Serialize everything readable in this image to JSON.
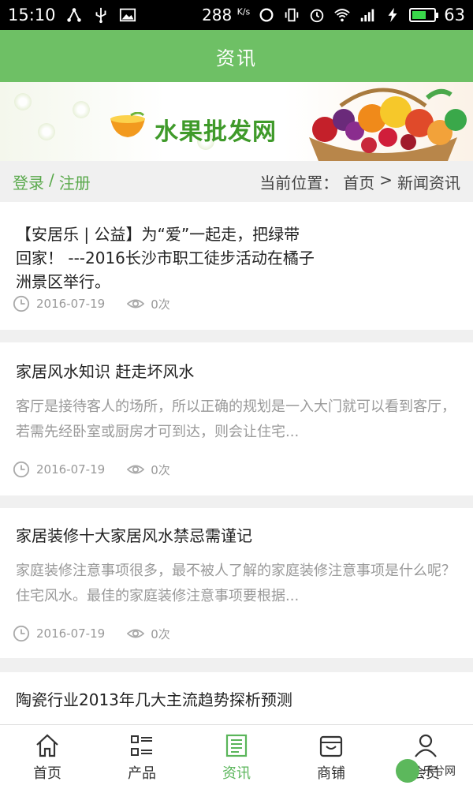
{
  "status": {
    "time": "15:10",
    "speed": "288",
    "speed_unit": "K/s",
    "battery": "63",
    "battery_fraction": 0.63
  },
  "header": {
    "title": "资讯"
  },
  "banner": {
    "title": "水果批发网"
  },
  "breadcrumb_bar": {
    "login": "登录",
    "separator": "/",
    "register": "注册",
    "location_label": "当前位置：",
    "home": "首页",
    "arrow": ">",
    "current": "新闻资讯"
  },
  "articles": [
    {
      "title": "【安居乐 | 公益】为“爱”一起走，把绿带回家！ ---2016长沙市职工徒步活动在橘子洲景区举行。",
      "summary": "",
      "date": "2016-07-19",
      "views": "0次"
    },
    {
      "title": "家居风水知识 赶走坏风水",
      "summary": "客厅是接待客人的场所，所以正确的规划是一入大门就可以看到客厅，若需先经卧室或厨房才可到达，则会让住宅...",
      "date": "2016-07-19",
      "views": "0次"
    },
    {
      "title": "家居装修十大家居风水禁忌需谨记",
      "summary": "家庭装修注意事项很多，最不被人了解的家庭装修注意事项是什么呢？住宅风水。最佳的家庭装修注意事项要根据...",
      "date": "2016-07-19",
      "views": "0次"
    },
    {
      "title": "陶瓷行业2013年几大主流趋势探析预测",
      "summary": "",
      "date": "",
      "views": ""
    }
  ],
  "nav": {
    "tabs": [
      {
        "label": "首页",
        "icon": "home-icon"
      },
      {
        "label": "产品",
        "icon": "list-grid-icon"
      },
      {
        "label": "资讯",
        "icon": "news-icon"
      },
      {
        "label": "商铺",
        "icon": "store-icon"
      },
      {
        "label": "会员",
        "icon": "user-icon"
      }
    ],
    "active_index": 2
  },
  "watermark": {
    "text": "乐兮网"
  },
  "colors": {
    "header_green": "#6ec065",
    "accent_green": "#5aa94c",
    "active_tab": "#5ab55a"
  }
}
